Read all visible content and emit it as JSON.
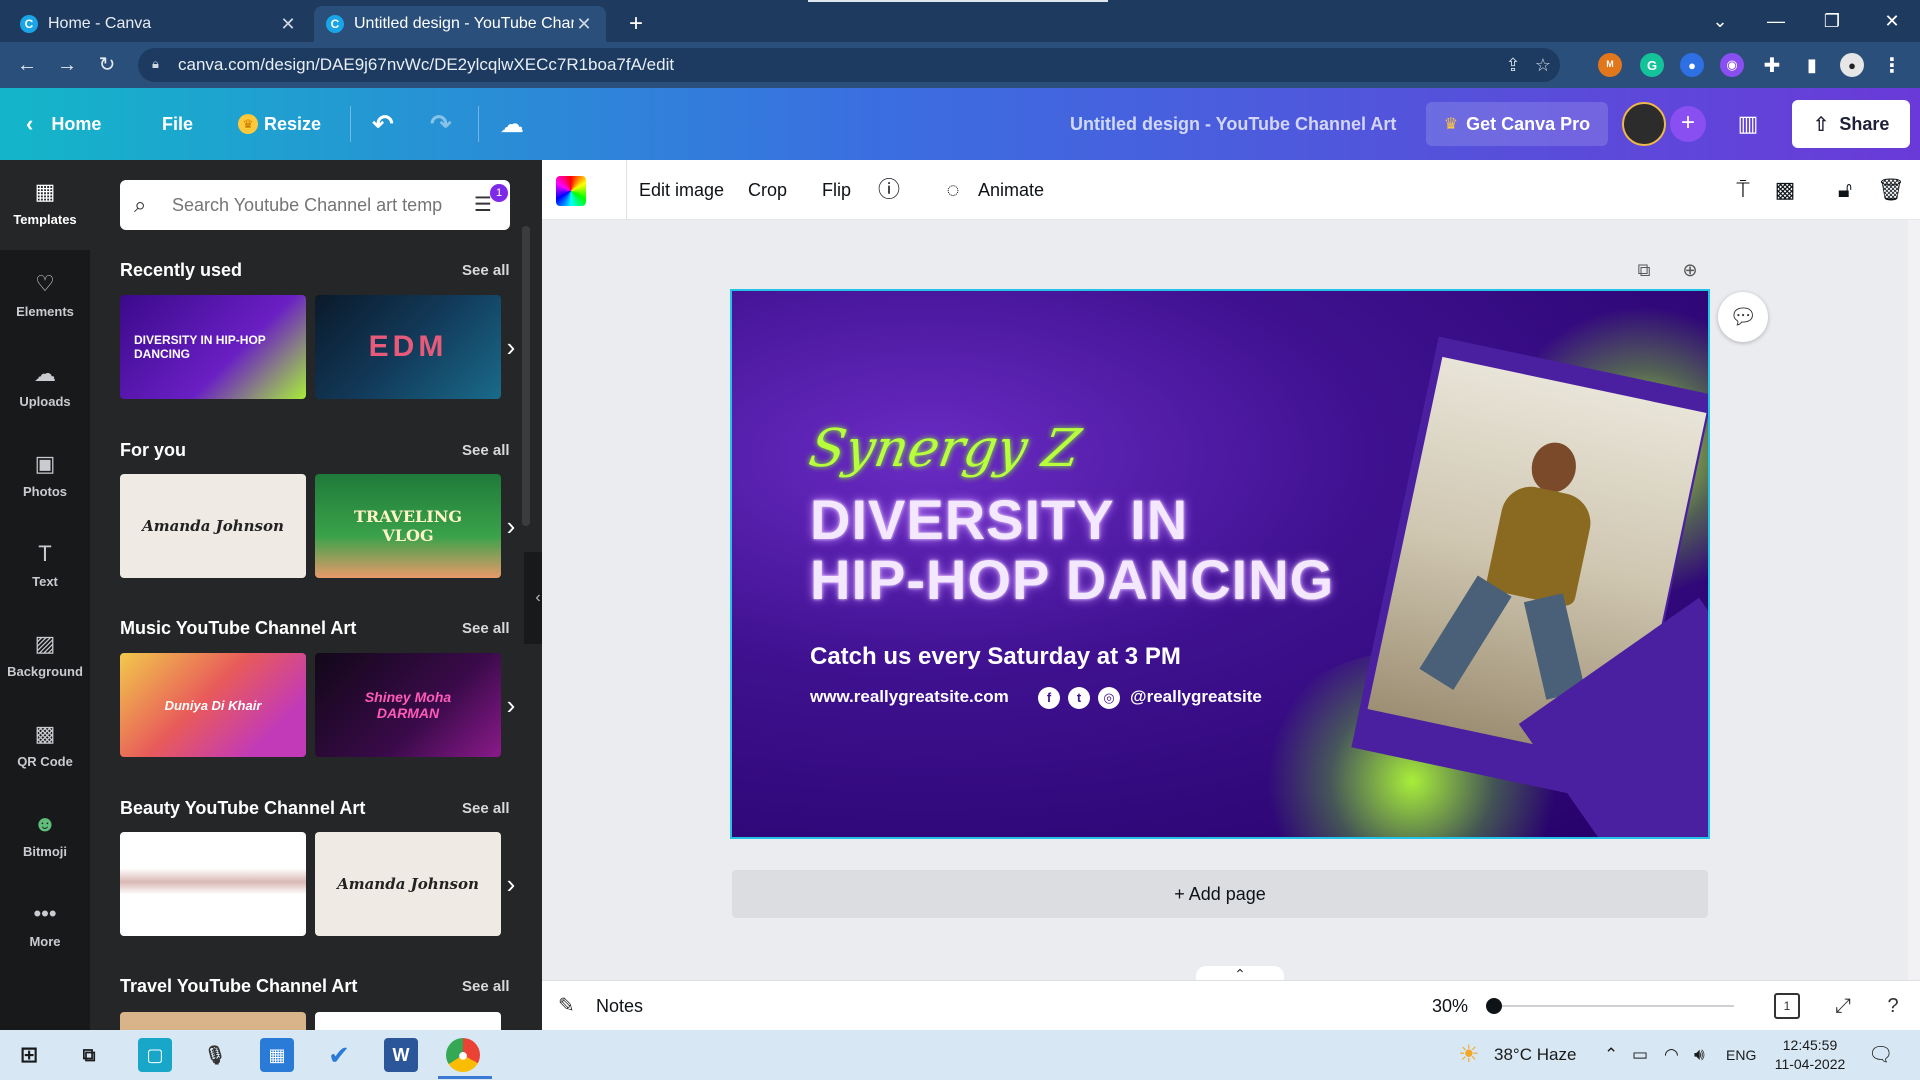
{
  "browser": {
    "tabs": [
      {
        "title": "Home - Canva"
      },
      {
        "title": "Untitled design - YouTube Chann"
      }
    ],
    "url": "canva.com/design/DAE9j67nvWc/DE2ylcqlwXECc7R1boa7fA/edit"
  },
  "header": {
    "home": "Home",
    "file": "File",
    "resize": "Resize",
    "design_title": "Untitled design - YouTube Channel Art",
    "get_pro": "Get Canva Pro",
    "share": "Share"
  },
  "rail": [
    {
      "label": "Templates",
      "icon": "templates-icon"
    },
    {
      "label": "Elements",
      "icon": "elements-icon"
    },
    {
      "label": "Uploads",
      "icon": "uploads-icon"
    },
    {
      "label": "Photos",
      "icon": "photos-icon"
    },
    {
      "label": "Text",
      "icon": "text-icon"
    },
    {
      "label": "Background",
      "icon": "background-icon"
    },
    {
      "label": "QR Code",
      "icon": "qr-code-icon"
    },
    {
      "label": "Bitmoji",
      "icon": "bitmoji-icon"
    },
    {
      "label": "More",
      "icon": "more-icon"
    }
  ],
  "panel": {
    "search_placeholder": "Search Youtube Channel art temp",
    "filter_badge": "1",
    "see_all": "See all",
    "sections": [
      {
        "title": "Recently used",
        "thumbs": [
          "DIVERSITY IN HIP-HOP DANCING",
          "EDM"
        ]
      },
      {
        "title": "For you",
        "thumbs": [
          "Amanda Johnson",
          "TRAVELING VLOG"
        ]
      },
      {
        "title": "Music YouTube Channel Art",
        "thumbs": [
          "Duniya Di Khair",
          "Shiney Moha DARMAN"
        ]
      },
      {
        "title": "Beauty YouTube Channel Art",
        "thumbs": [
          "",
          "Amanda Johnson"
        ]
      },
      {
        "title": "Travel YouTube Channel Art",
        "thumbs": [
          "",
          ""
        ]
      }
    ]
  },
  "toolbar": {
    "edit_image": "Edit image",
    "crop": "Crop",
    "flip": "Flip",
    "animate": "Animate"
  },
  "design": {
    "script": "Synergy Z",
    "line1": "DIVERSITY IN",
    "line2": "HIP-HOP DANCING",
    "catch": "Catch us every Saturday at 3 PM",
    "website": "www.reallygreatsite.com",
    "handle": "@reallygreatsite"
  },
  "add_page": "+ Add page",
  "footer": {
    "notes": "Notes",
    "zoom": "30%",
    "page_count": "1"
  },
  "taskbar": {
    "weather": "38°C  Haze",
    "lang": "ENG",
    "time": "12:45:59",
    "date": "11-04-2022"
  }
}
